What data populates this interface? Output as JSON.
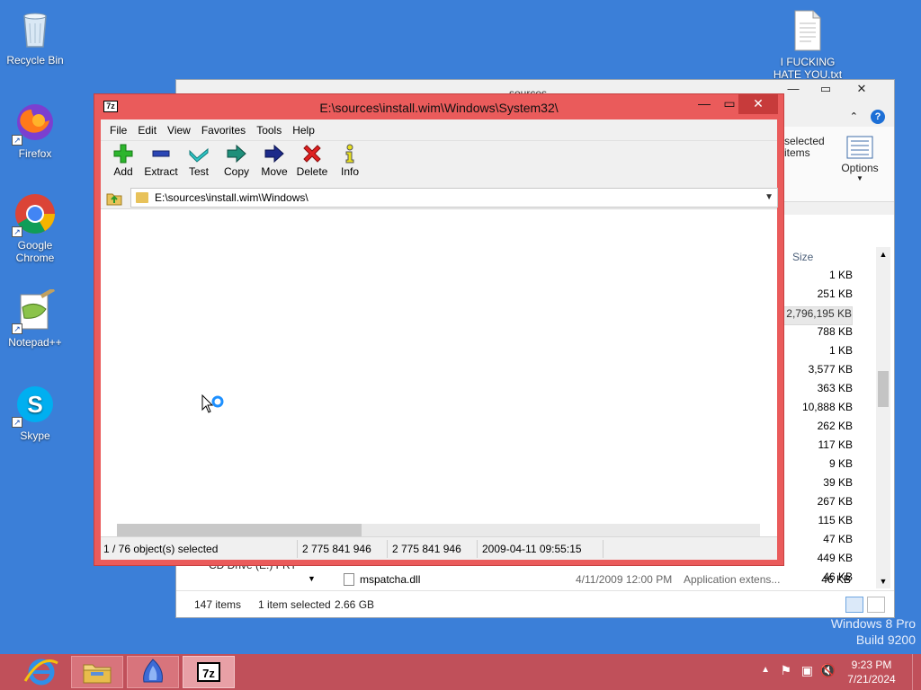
{
  "desktop": {
    "icons": [
      {
        "label": "Recycle Bin"
      },
      {
        "label": "Firefox"
      },
      {
        "label": "Google Chrome"
      },
      {
        "label": "Notepad++"
      },
      {
        "label": "Skype"
      },
      {
        "label": "I FUCKING HATE YOU.txt"
      }
    ],
    "watermark_line1": "Windows 8 Pro",
    "watermark_line2": "Build 9200"
  },
  "explorer": {
    "title": "sources",
    "ribbon_selected": "selected items",
    "ribbon_options": "Options",
    "col_size": "Size",
    "sizes": [
      "1 KB",
      "251 KB",
      "2,796,195 KB",
      "788 KB",
      "1 KB",
      "3,577 KB",
      "363 KB",
      "10,888 KB",
      "262 KB",
      "117 KB",
      "9 KB",
      "39 KB",
      "267 KB",
      "115 KB",
      "47 KB",
      "449 KB",
      "46 KB"
    ],
    "nav_partial": "CD Drive (E:) FRT",
    "last_row": {
      "name": "mspatcha.dll",
      "date": "4/11/2009 12:00 PM",
      "type": "Application extens...",
      "size": "46 KB"
    },
    "status_items": "147 items",
    "status_selected": "1 item selected",
    "status_size": "2.66 GB"
  },
  "sevenzip": {
    "title": "E:\\sources\\install.wim\\Windows\\System32\\",
    "menu": [
      "File",
      "Edit",
      "View",
      "Favorites",
      "Tools",
      "Help"
    ],
    "toolbar": [
      {
        "label": "Add",
        "icon": "plus-icon"
      },
      {
        "label": "Extract",
        "icon": "minus-icon"
      },
      {
        "label": "Test",
        "icon": "check-icon"
      },
      {
        "label": "Copy",
        "icon": "copy-arrow-icon"
      },
      {
        "label": "Move",
        "icon": "move-arrow-icon"
      },
      {
        "label": "Delete",
        "icon": "x-icon"
      },
      {
        "label": "Info",
        "icon": "info-icon"
      }
    ],
    "address": "E:\\sources\\install.wim\\Windows\\",
    "status": {
      "selected": "1 / 76 object(s) selected",
      "size": "2 775 841 946",
      "packed": "2 775 841 946",
      "modified": "2009-04-11 09:55:15"
    }
  },
  "taskbar": {
    "time": "9:23 PM",
    "date": "7/21/2024"
  },
  "colors": {
    "desktop": "#3b7fd8",
    "active_frame": "#ea5b5b",
    "taskbar": "#c0505a"
  }
}
